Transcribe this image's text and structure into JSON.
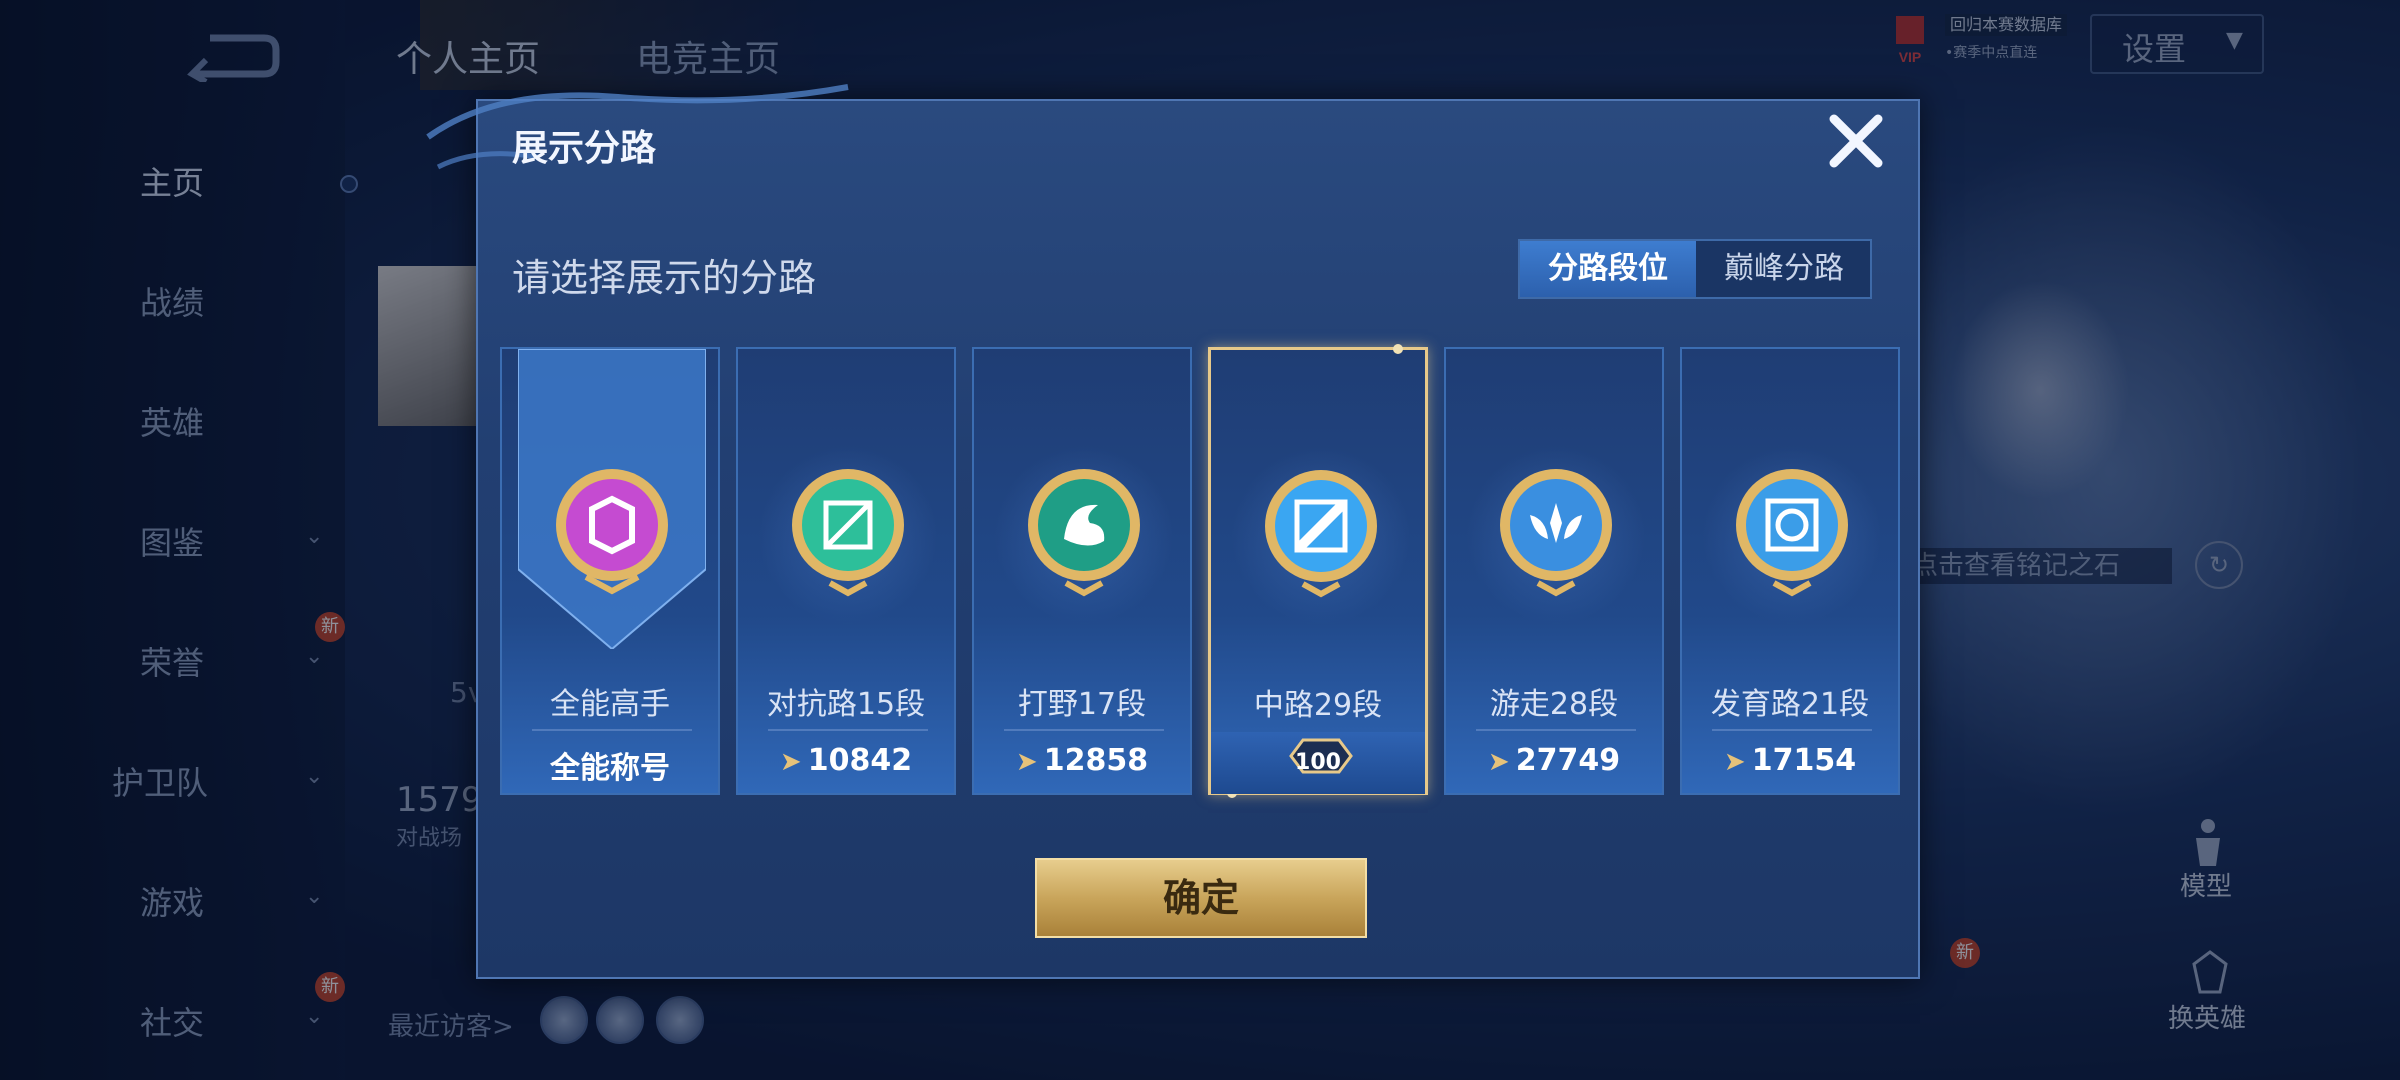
{
  "nav": {
    "items": [
      {
        "label": "主页",
        "chevron": false,
        "new": false
      },
      {
        "label": "战绩",
        "chevron": false,
        "new": false
      },
      {
        "label": "英雄",
        "chevron": false,
        "new": false
      },
      {
        "label": "图鉴",
        "chevron": true,
        "new": false
      },
      {
        "label": "荣誉",
        "chevron": true,
        "new": true
      },
      {
        "label": "护卫队",
        "chevron": true,
        "new": false
      },
      {
        "label": "游戏",
        "chevron": true,
        "new": false
      },
      {
        "label": "社交",
        "chevron": true,
        "new": true
      }
    ],
    "new_badge": "新"
  },
  "top": {
    "tab_profile": "个人主页",
    "tab_other": "电竞主页",
    "settings": "设置",
    "vip_line1": "回归本赛数据库",
    "vip_line2": "•赛季中点直连"
  },
  "background": {
    "number": "1579",
    "sub": "对战场",
    "level": "5v",
    "visitors": "最近访客>",
    "inscription": "点击查看铭记之石",
    "model": "模型",
    "change_hero": "换英雄"
  },
  "modal": {
    "title": "展示分路",
    "subtitle": "请选择展示的分路",
    "toggle_on": "分路段位",
    "toggle_off": "巅峰分路",
    "confirm": "确定",
    "cards": [
      {
        "lane": "全能高手",
        "value": "全能称号",
        "color": "#c54bd1",
        "icon": "all-round-emblem"
      },
      {
        "lane": "对抗路15段",
        "value": "10842",
        "color": "#2dbf9a",
        "icon": "clash-lane-emblem"
      },
      {
        "lane": "打野17段",
        "value": "12858",
        "color": "#1f9e86",
        "icon": "jungle-emblem"
      },
      {
        "lane": "中路29段",
        "value": "100",
        "color": "#3aa6f2",
        "icon": "mid-lane-emblem"
      },
      {
        "lane": "游走28段",
        "value": "27749",
        "color": "#3a8fe0",
        "icon": "roam-emblem"
      },
      {
        "lane": "发育路21段",
        "value": "17154",
        "color": "#3b9de8",
        "icon": "farm-lane-emblem"
      }
    ]
  },
  "colors": {
    "accent_gold": "#e7c98a",
    "toggle_active": "#3e7dd0"
  }
}
